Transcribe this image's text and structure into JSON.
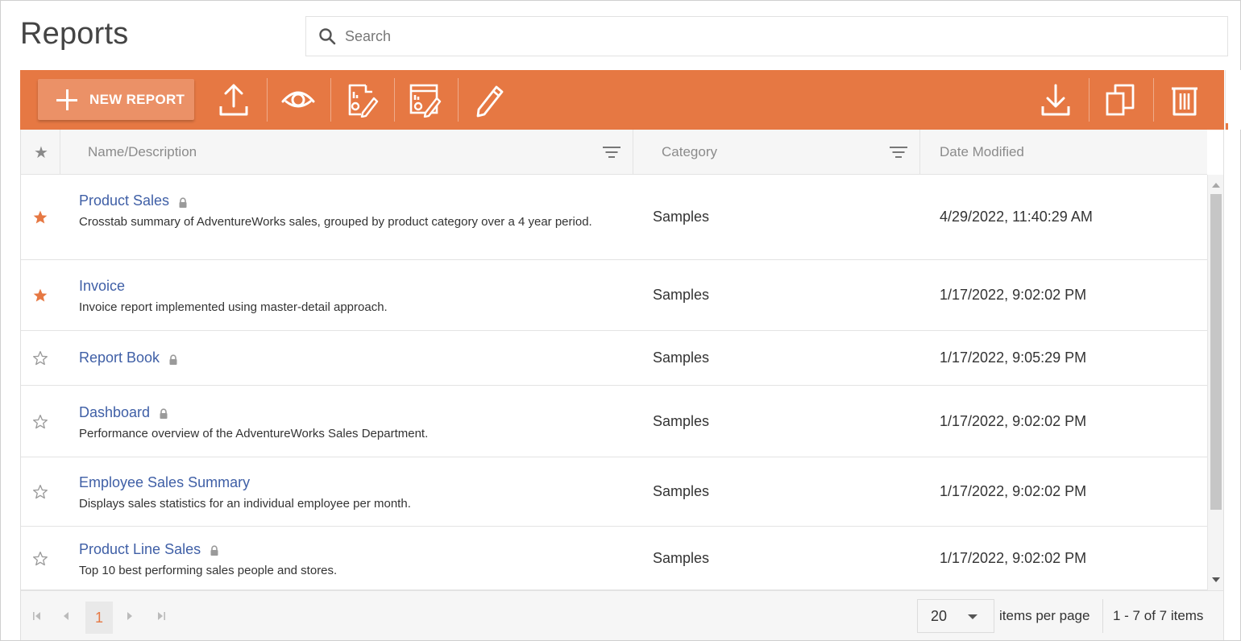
{
  "page": {
    "title": "Reports"
  },
  "search": {
    "placeholder": "Search",
    "value": "",
    "icon": "search-icon"
  },
  "toolbar": {
    "background": "#e67843",
    "new_report_label": "NEW REPORT",
    "left_icons": [
      "upload-icon",
      "eye-icon",
      "design-report-icon",
      "design-dashboard-icon",
      "pencil-icon"
    ],
    "right_icons": [
      "download-icon",
      "copy-icon",
      "trash-icon"
    ]
  },
  "table": {
    "columns": {
      "favorite": "★",
      "name": "Name/Description",
      "category": "Category",
      "date": "Date Modified"
    },
    "rows": [
      {
        "favorite": true,
        "name": "Product Sales",
        "locked": true,
        "description": "Crosstab summary of AdventureWorks sales, grouped by product category over a 4 year period.",
        "category": "Samples",
        "date": "4/29/2022, 11:40:29 AM"
      },
      {
        "favorite": true,
        "name": "Invoice",
        "locked": false,
        "description": "Invoice report implemented using master-detail approach.",
        "category": "Samples",
        "date": "1/17/2022, 9:02:02 PM"
      },
      {
        "favorite": false,
        "name": "Report Book",
        "locked": true,
        "description": "",
        "category": "Samples",
        "date": "1/17/2022, 9:05:29 PM"
      },
      {
        "favorite": false,
        "name": "Dashboard",
        "locked": true,
        "description": "Performance overview of the AdventureWorks Sales Department.",
        "category": "Samples",
        "date": "1/17/2022, 9:02:02 PM"
      },
      {
        "favorite": false,
        "name": "Employee Sales Summary",
        "locked": false,
        "description": "Displays sales statistics for an individual employee per month.",
        "category": "Samples",
        "date": "1/17/2022, 9:02:02 PM"
      },
      {
        "favorite": false,
        "name": "Product Line Sales",
        "locked": true,
        "description": "Top 10 best performing sales people and stores.",
        "category": "Samples",
        "date": "1/17/2022, 9:02:02 PM"
      }
    ]
  },
  "pager": {
    "current_page": "1",
    "page_size": "20",
    "items_per_page_label": "items per page",
    "info": "1 - 7 of 7 items"
  },
  "colors": {
    "accent": "#e67843",
    "link": "#3f5fa6",
    "star_on": "#e67843",
    "star_off": "#9a9a9a"
  }
}
